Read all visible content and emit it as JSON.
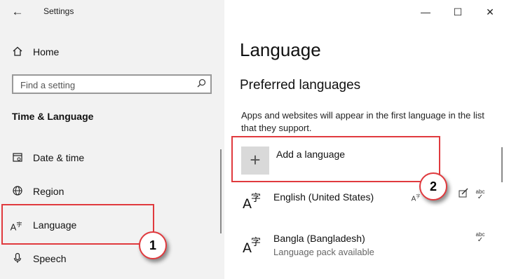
{
  "window": {
    "title": "Settings"
  },
  "sidebar": {
    "home_label": "Home",
    "search": {
      "placeholder": "Find a setting"
    },
    "section_header": "Time & Language",
    "items": [
      {
        "label": "Date & time",
        "icon": "calendar-icon"
      },
      {
        "label": "Region",
        "icon": "globe-icon"
      },
      {
        "label": "Language",
        "icon": "language-icon",
        "selected": true
      },
      {
        "label": "Speech",
        "icon": "microphone-icon"
      }
    ]
  },
  "main": {
    "title": "Language",
    "subtitle": "Preferred languages",
    "description": "Apps and websites will appear in the first language in the list that they support.",
    "add_language_label": "Add a language",
    "languages": [
      {
        "name": "English (United States)",
        "sub": ""
      },
      {
        "name": "Bangla (Bangladesh)",
        "sub": "Language pack available"
      }
    ]
  },
  "annotations": {
    "step1": "1",
    "step2": "2",
    "color": "#e03a3e"
  },
  "colors": {
    "sidebar_bg": "#f2f2f2",
    "add_button_bg": "#d9d9d9"
  }
}
